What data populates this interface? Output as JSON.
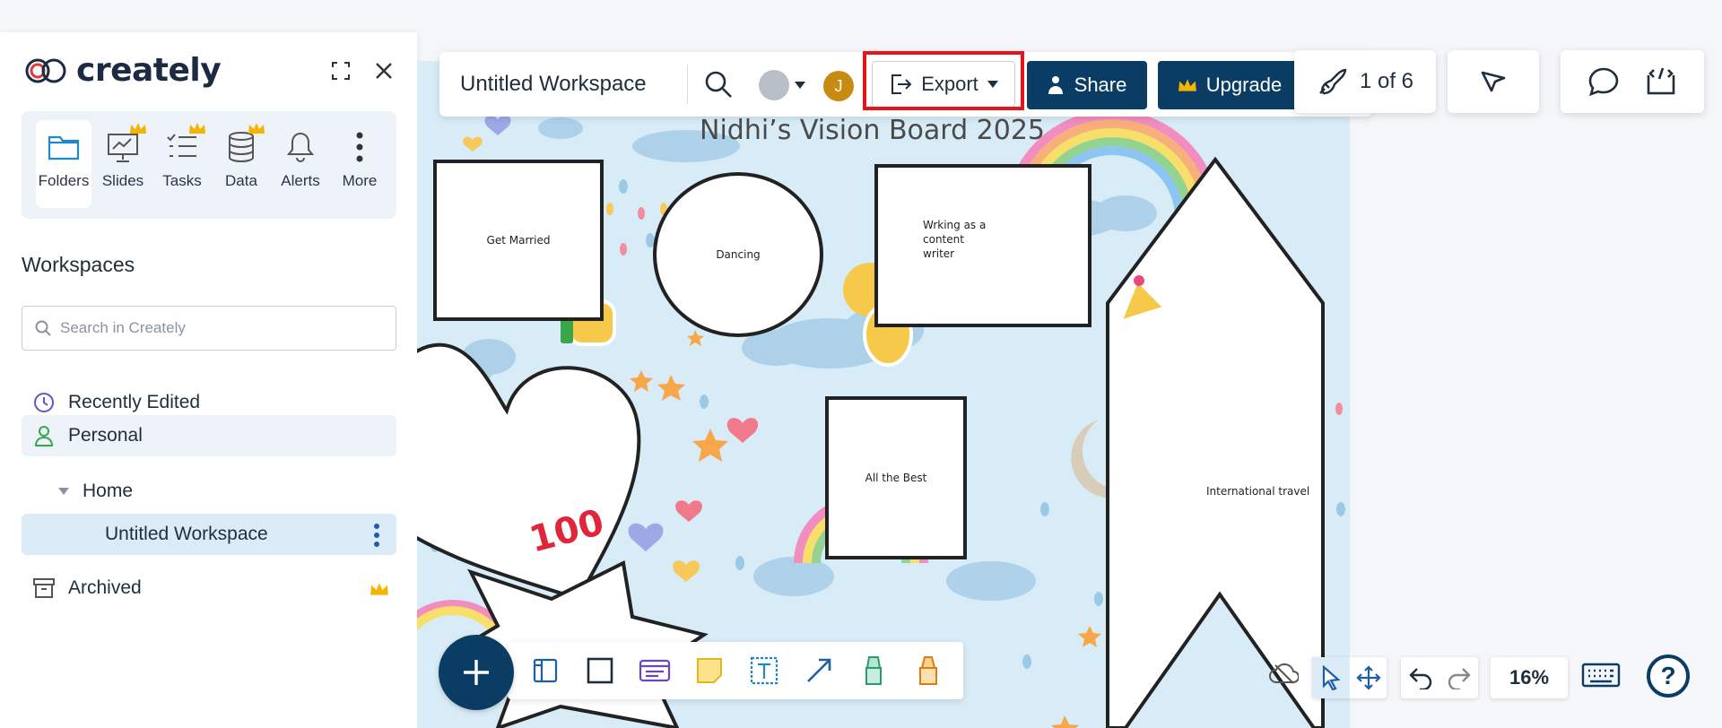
{
  "app": {
    "logo_text": "creately"
  },
  "sidebar": {
    "nav": [
      {
        "label": "Folders",
        "icon": "folder-icon",
        "active": true
      },
      {
        "label": "Slides",
        "icon": "slides-icon",
        "premium": true
      },
      {
        "label": "Tasks",
        "icon": "tasks-icon",
        "premium": true
      },
      {
        "label": "Data",
        "icon": "data-icon",
        "premium": true
      },
      {
        "label": "Alerts",
        "icon": "bell-icon"
      },
      {
        "label": "More",
        "icon": "more-vertical-icon"
      }
    ],
    "section_title": "Workspaces",
    "search_placeholder": "Search in Creately",
    "tree": {
      "recently_edited": "Recently Edited",
      "personal": "Personal",
      "home": "Home",
      "workspace": "Untitled Workspace",
      "archived": "Archived"
    }
  },
  "toolbar": {
    "workspace_title": "Untitled Workspace",
    "avatar_initial": "J",
    "export_label": "Export",
    "share_label": "Share",
    "upgrade_label": "Upgrade",
    "pages_label": "1 of 6"
  },
  "board": {
    "title": "Nidhi’s Vision Board 2025",
    "shapes": {
      "get_married": "Get Married",
      "dancing": "Dancing",
      "writing": "Wrking as a content writer",
      "all_the_best": "All the Best",
      "international_travel": "International travel"
    }
  },
  "bottom_right": {
    "zoom": "16%",
    "help": "?"
  },
  "colors": {
    "primary": "#0b3d64",
    "highlight": "#e0161c",
    "canvas_bg": "#d8ecf7",
    "avatar": "#c98a12"
  }
}
